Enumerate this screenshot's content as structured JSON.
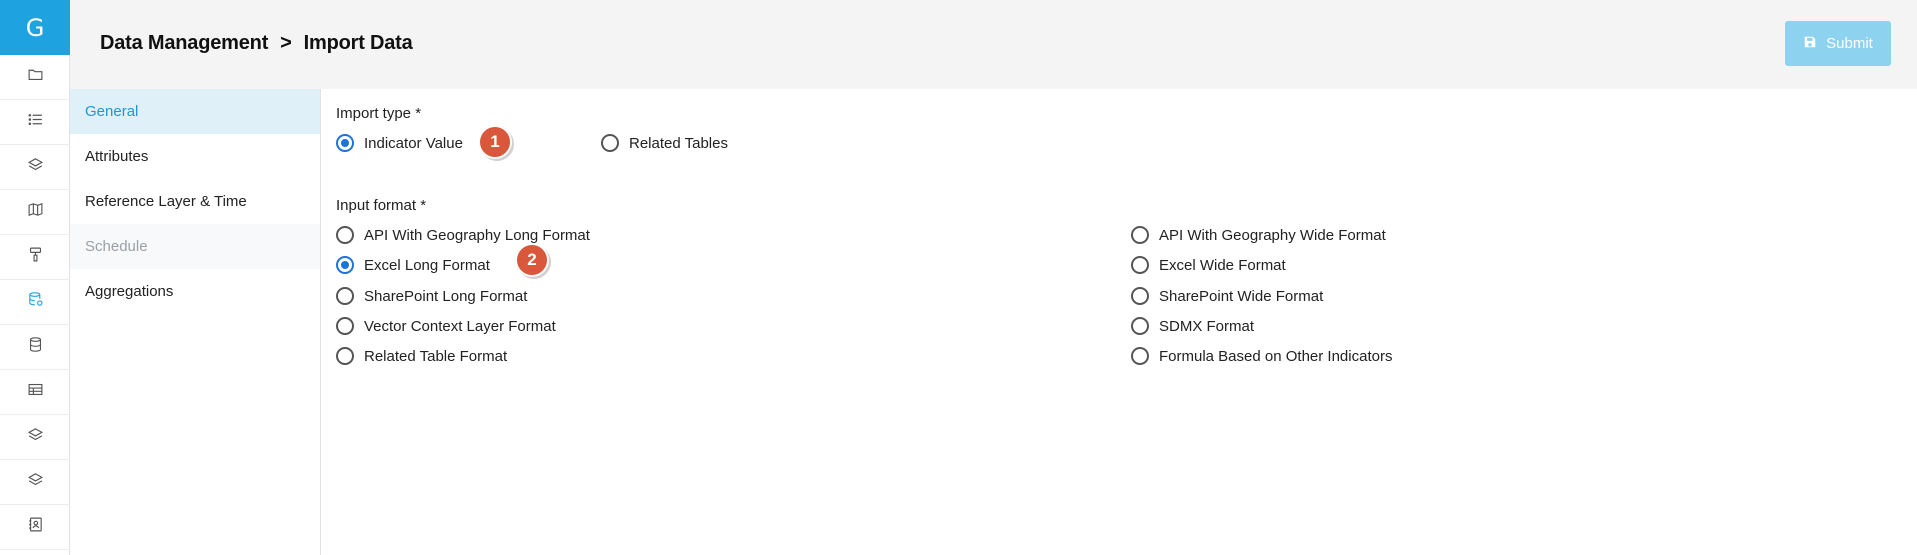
{
  "app": {
    "logo_letter": "G"
  },
  "rail": {
    "items": [
      {
        "icon": "folder-icon"
      },
      {
        "icon": "list-icon"
      },
      {
        "icon": "layers-icon"
      },
      {
        "icon": "map-icon"
      },
      {
        "icon": "paint-roller-icon"
      },
      {
        "icon": "database-settings-icon",
        "active": true
      },
      {
        "icon": "database-icon"
      },
      {
        "icon": "table-icon"
      },
      {
        "icon": "layers-icon"
      },
      {
        "icon": "layers-icon"
      },
      {
        "icon": "contact-book-icon"
      }
    ]
  },
  "header": {
    "breadcrumb_root": "Data Management",
    "breadcrumb_separator": ">",
    "breadcrumb_current": "Import Data",
    "submit_label": "Submit"
  },
  "subnav": {
    "items": [
      {
        "label": "General",
        "state": "active"
      },
      {
        "label": "Attributes",
        "state": "normal"
      },
      {
        "label": "Reference Layer & Time",
        "state": "normal"
      },
      {
        "label": "Schedule",
        "state": "disabled"
      },
      {
        "label": "Aggregations",
        "state": "normal"
      }
    ]
  },
  "form": {
    "import_type_label": "Import type *",
    "import_type_options": [
      {
        "label": "Indicator Value",
        "checked": true
      },
      {
        "label": "Related Tables",
        "checked": false
      }
    ],
    "input_format_label": "Input format *",
    "input_format_left": [
      {
        "label": "API With Geography Long Format",
        "checked": false
      },
      {
        "label": "Excel Long Format",
        "checked": true
      },
      {
        "label": "SharePoint Long Format",
        "checked": false
      },
      {
        "label": "Vector Context Layer Format",
        "checked": false
      },
      {
        "label": "Related Table Format",
        "checked": false
      }
    ],
    "input_format_right": [
      {
        "label": "API With Geography Wide Format",
        "checked": false
      },
      {
        "label": "Excel Wide Format",
        "checked": false
      },
      {
        "label": "SharePoint Wide Format",
        "checked": false
      },
      {
        "label": "SDMX Format",
        "checked": false
      },
      {
        "label": "Formula Based on Other Indicators",
        "checked": false
      }
    ]
  },
  "annotations": {
    "badge_1": "1",
    "badge_2": "2"
  },
  "colors": {
    "accent": "#1ea3e0",
    "radio_checked": "#1e73d8",
    "badge": "#d9573a",
    "submit_bg": "#8dd2ef"
  }
}
